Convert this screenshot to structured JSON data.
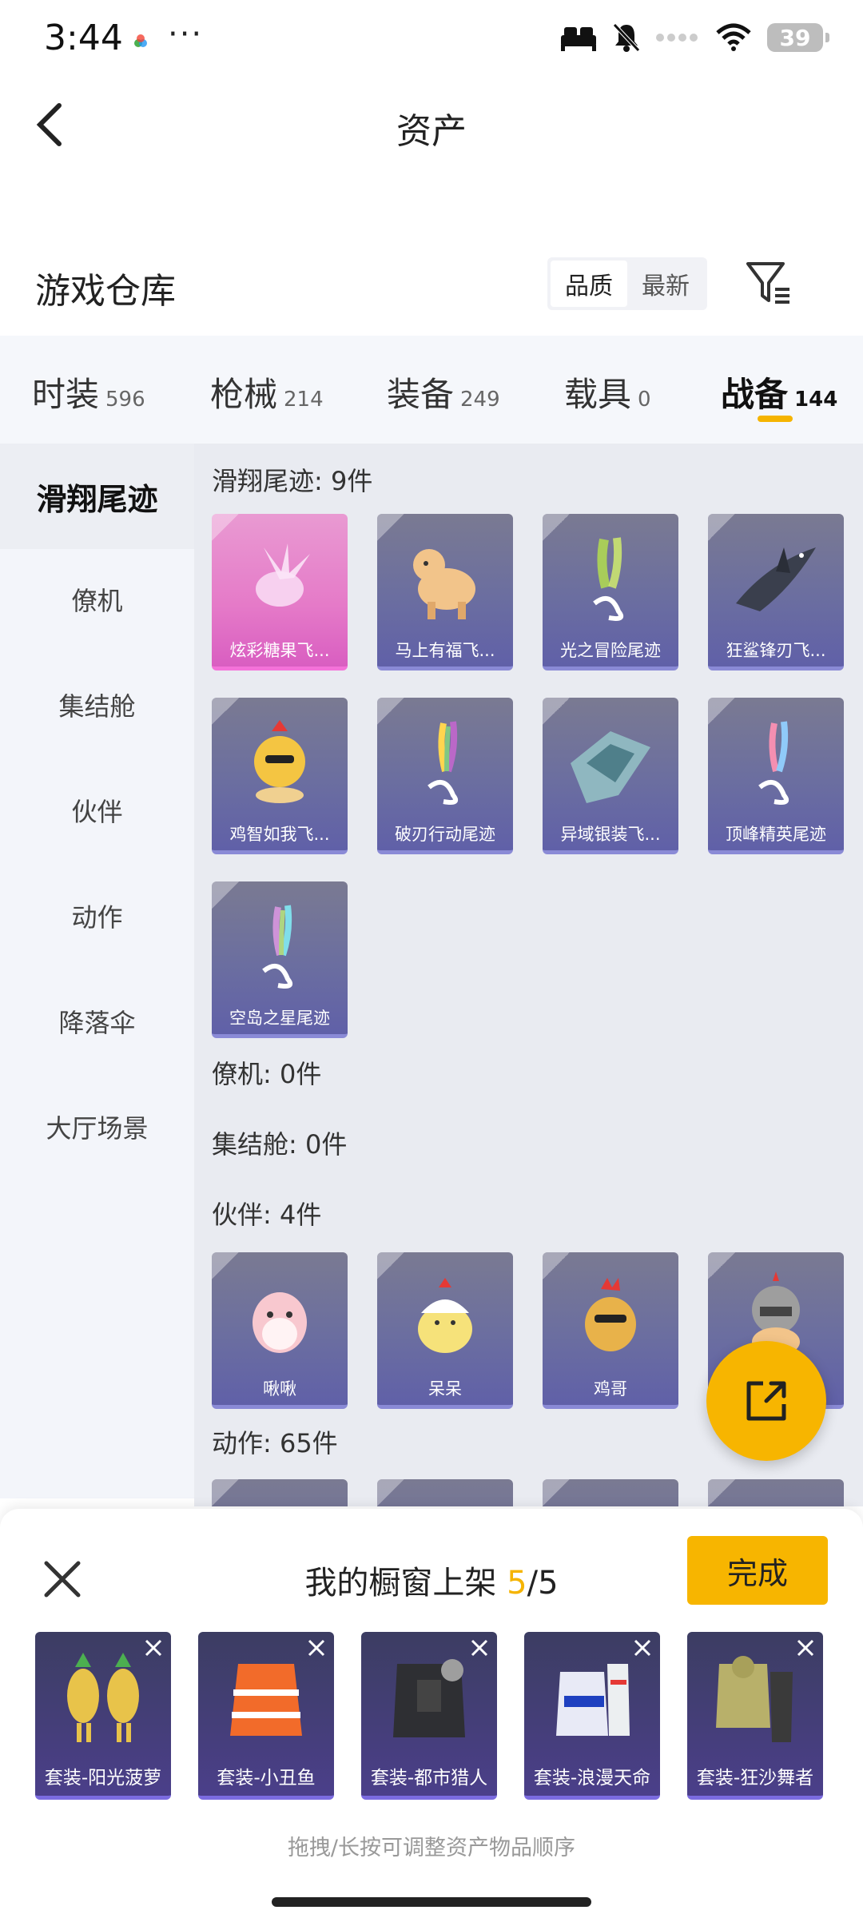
{
  "status_bar": {
    "time": "3:44",
    "dots": "···",
    "battery": "39"
  },
  "header": {
    "title": "资产"
  },
  "warehouse": {
    "title": "游戏仓库",
    "sort_options": [
      "品质",
      "最新"
    ]
  },
  "tabs": [
    {
      "label": "时装",
      "count": "596"
    },
    {
      "label": "枪械",
      "count": "214"
    },
    {
      "label": "装备",
      "count": "249"
    },
    {
      "label": "载具",
      "count": "0"
    },
    {
      "label": "战备",
      "count": "144"
    }
  ],
  "sidebar": {
    "items": [
      "滑翔尾迹",
      "僚机",
      "集结舱",
      "伙伴",
      "动作",
      "降落伞",
      "大厅场景"
    ]
  },
  "content": {
    "groups": [
      {
        "title": "滑翔尾迹: 9件",
        "items": [
          "炫彩糖果飞...",
          "马上有福飞...",
          "光之冒险尾迹",
          "狂鲨锋刃飞...",
          "鸡智如我飞...",
          "破刃行动尾迹",
          "异域银装飞...",
          "顶峰精英尾迹",
          "空岛之星尾迹"
        ]
      },
      {
        "title": "僚机: 0件"
      },
      {
        "title": "集结舱: 0件"
      },
      {
        "title": "伙伴: 4件",
        "items": [
          "啾啾",
          "呆呆",
          "鸡哥",
          ""
        ]
      },
      {
        "title": "动作: 65件"
      }
    ]
  },
  "showcase": {
    "title": "我的橱窗上架 ",
    "count": "5",
    "total": "/5",
    "done_label": "完成",
    "items": [
      "套装-阳光菠萝",
      "套装-小丑鱼",
      "套装-都市猎人",
      "套装-浪漫天命",
      "套装-狂沙舞者"
    ],
    "hint": "拖拽/长按可调整资产物品顺序"
  },
  "colors": {
    "accent": "#f7b500",
    "card_purple": "#6b6ea0",
    "card_pink": "#e57ac8"
  }
}
